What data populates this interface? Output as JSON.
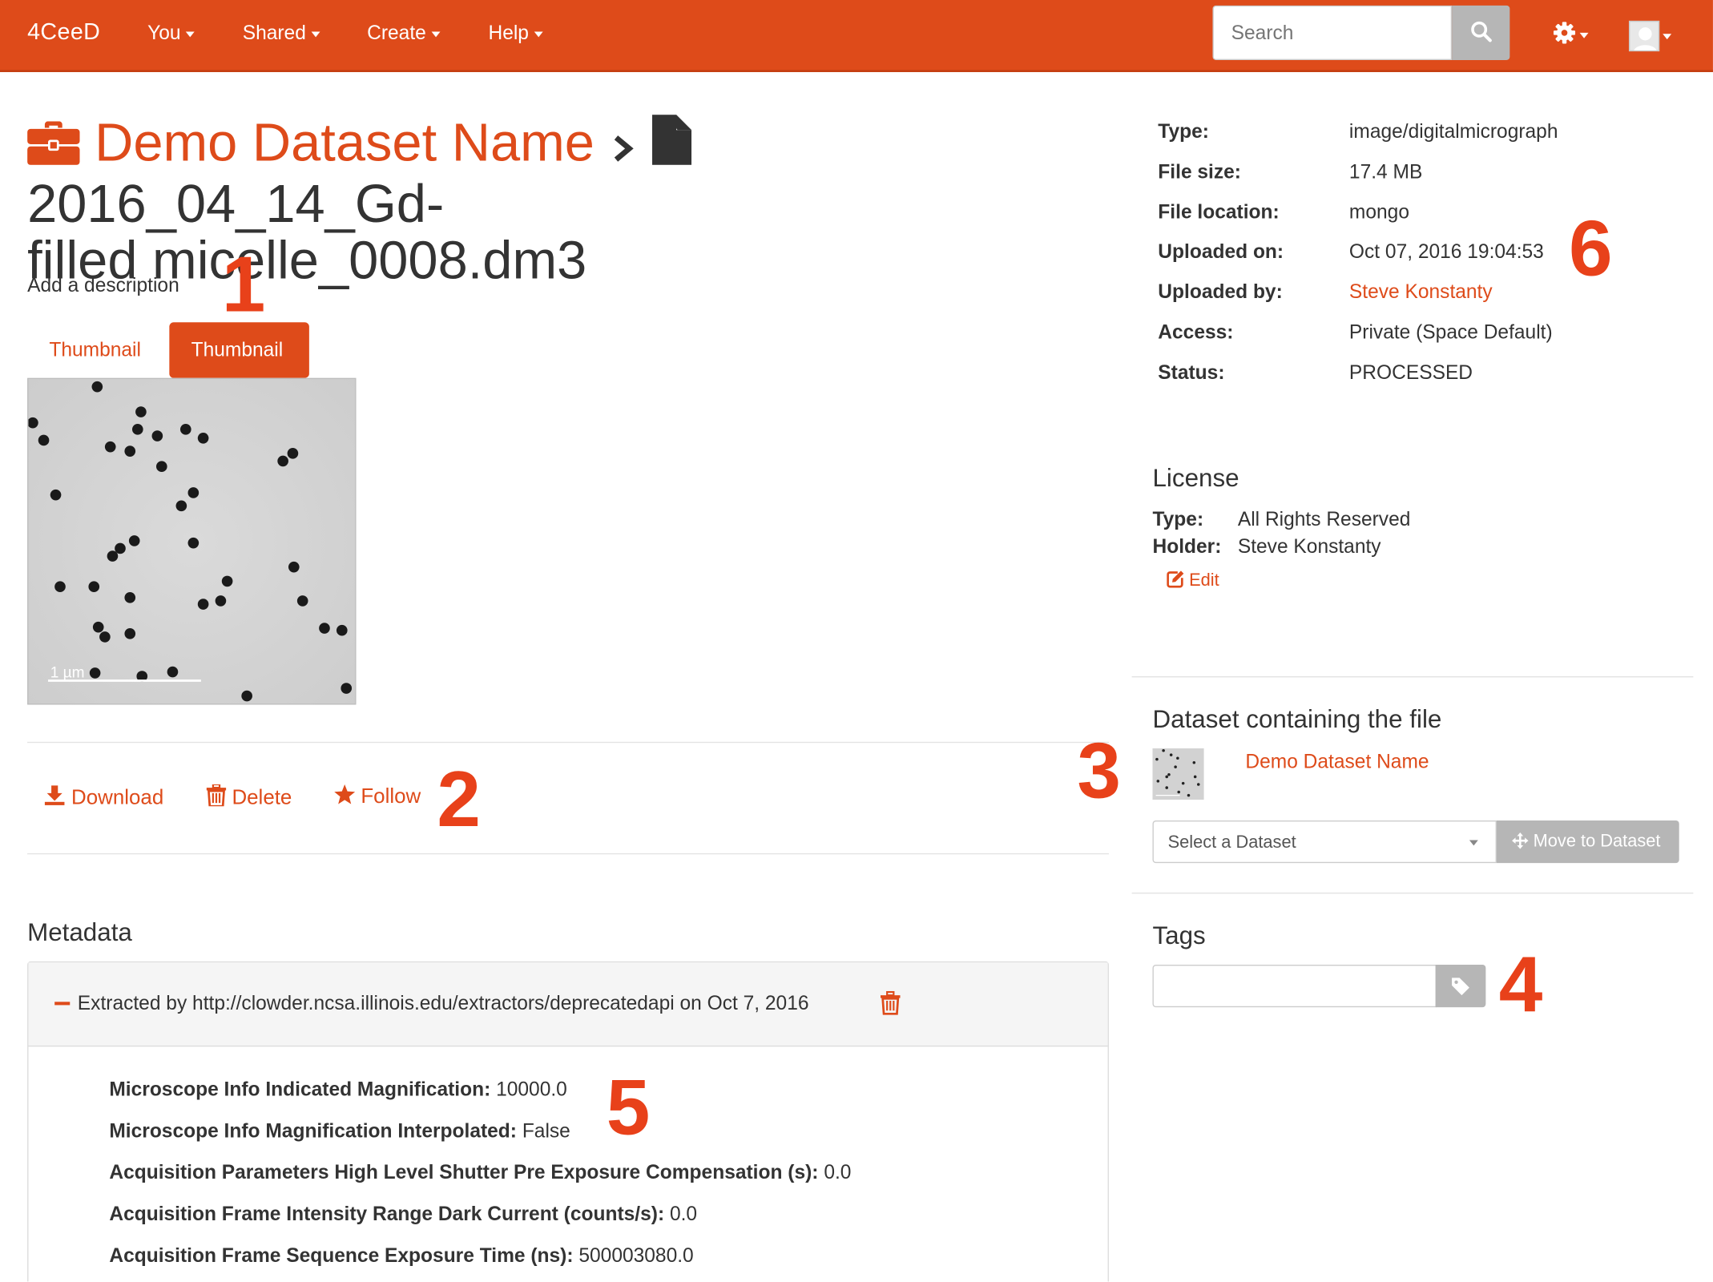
{
  "navbar": {
    "brand": "4CeeD",
    "menu": [
      {
        "label": "You"
      },
      {
        "label": "Shared"
      },
      {
        "label": "Create"
      },
      {
        "label": "Help"
      }
    ],
    "search_placeholder": "Search"
  },
  "title": {
    "dataset_name": "Demo Dataset Name",
    "file_name_line1": "2016_04_14_Gd-",
    "file_name_line2": "filled micelle_0008.dm3"
  },
  "description_prompt": "Add a description",
  "tabs": [
    {
      "label": "Thumbnail",
      "active": false
    },
    {
      "label": "Thumbnail",
      "active": true
    }
  ],
  "thumbnail": {
    "scale_bar_label": "1 µm"
  },
  "actions": {
    "download": "Download",
    "delete": "Delete",
    "follow": "Follow"
  },
  "metadata": {
    "heading": "Metadata",
    "extractor_header": "Extracted by http://clowder.ncsa.illinois.edu/extractors/deprecatedapi on Oct 7, 2016",
    "rows": [
      {
        "key": "Microscope Info Indicated Magnification:",
        "value": "10000.0"
      },
      {
        "key": "Microscope Info Magnification Interpolated:",
        "value": "False"
      },
      {
        "key": "Acquisition Parameters High Level Shutter Pre Exposure Compensation (s):",
        "value": "0.0"
      },
      {
        "key": "Acquisition Frame Intensity Range Dark Current (counts/s):",
        "value": "0.0"
      },
      {
        "key": "Acquisition Frame Sequence Exposure Time (ns):",
        "value": "500003080.0"
      }
    ]
  },
  "file_info": [
    {
      "key": "Type:",
      "value": "image/digitalmicrograph"
    },
    {
      "key": "File size:",
      "value": "17.4 MB"
    },
    {
      "key": "File location:",
      "value": "mongo"
    },
    {
      "key": "Uploaded on:",
      "value": "Oct 07, 2016 19:04:53"
    },
    {
      "key": "Uploaded by:",
      "value": "Steve Konstanty"
    },
    {
      "key": "Access:",
      "value": "Private (Space Default)"
    },
    {
      "key": "Status:",
      "value": "PROCESSED"
    }
  ],
  "license": {
    "heading": "License",
    "type_key": "Type:",
    "type_value": "All Rights Reserved",
    "holder_key": "Holder:",
    "holder_value": "Steve Konstanty",
    "edit_label": "Edit"
  },
  "dataset_section": {
    "heading": "Dataset containing the file",
    "dataset_name": "Demo Dataset Name",
    "select_placeholder": "Select a Dataset",
    "move_button": "Move to Dataset"
  },
  "tags": {
    "heading": "Tags"
  },
  "annotations": [
    "1",
    "2",
    "3",
    "4",
    "5",
    "6"
  ],
  "colors": {
    "brand_orange": "#de4b1a",
    "annotation_red": "#e8411a",
    "button_gray": "#b6b6b6"
  },
  "icons": [
    "search-icon",
    "gear-icon",
    "user-avatar-icon",
    "briefcase-icon",
    "chevron-right-icon",
    "file-icon",
    "download-icon",
    "trash-icon",
    "star-icon",
    "edit-icon",
    "move-icon",
    "tag-icon",
    "minus-icon"
  ]
}
